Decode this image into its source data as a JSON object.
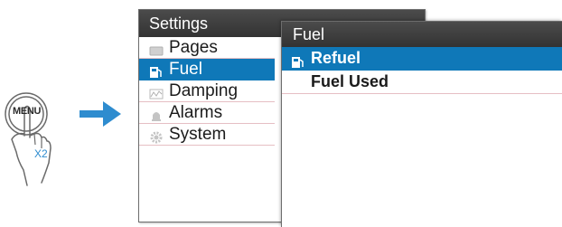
{
  "illustration": {
    "button_label": "MENU",
    "press_count": "X2"
  },
  "settings_menu": {
    "title": "Settings",
    "items": [
      {
        "label": "Pages",
        "icon": "pages-icon",
        "selected": false
      },
      {
        "label": "Fuel",
        "icon": "fuel-pump-icon",
        "selected": true
      },
      {
        "label": "Damping",
        "icon": "damping-icon",
        "selected": false
      },
      {
        "label": "Alarms",
        "icon": "bell-icon",
        "selected": false
      },
      {
        "label": "System",
        "icon": "gear-icon",
        "selected": false
      }
    ]
  },
  "fuel_menu": {
    "title": "Fuel",
    "items": [
      {
        "label": "Refuel",
        "icon": "fuel-pump-icon",
        "selected": true
      },
      {
        "label": "Fuel Used",
        "icon": "",
        "selected": false
      }
    ]
  },
  "colors": {
    "selection": "#0f78b8",
    "header": "#3c3c3c",
    "accent_arrow": "#2e8ccf",
    "separator": "#e6bfc4"
  }
}
